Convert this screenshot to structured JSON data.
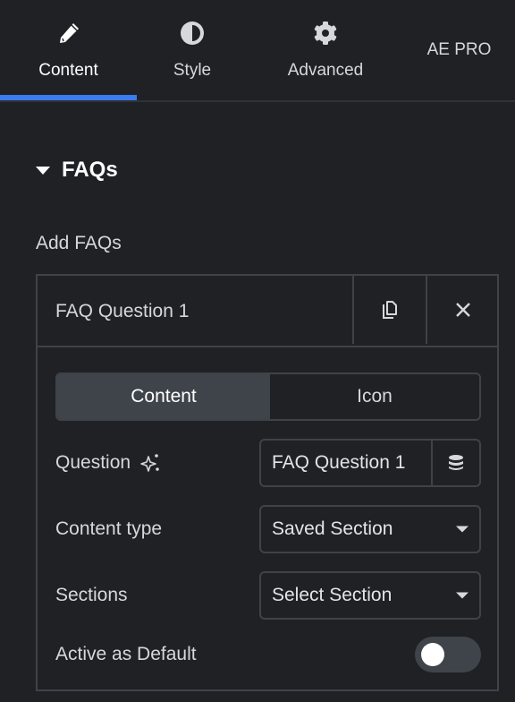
{
  "tabs": [
    {
      "label": "Content",
      "icon": "pencil-icon",
      "active": true
    },
    {
      "label": "Style",
      "icon": "half-circle-icon",
      "active": false
    },
    {
      "label": "Advanced",
      "icon": "gear-icon",
      "active": false
    },
    {
      "label": "AE PRO",
      "active": false
    }
  ],
  "colors": {
    "accent": "#3a7bef",
    "background": "#1f2124",
    "border": "#3f4248"
  },
  "section": {
    "title": "FAQs",
    "expanded": true
  },
  "repeater": {
    "label": "Add FAQs",
    "item": {
      "title": "FAQ Question 1",
      "duplicate_icon": "copy-icon",
      "remove_icon": "close-icon",
      "switcher": {
        "options": [
          "Content",
          "Icon"
        ],
        "selected": "Content"
      },
      "fields": {
        "question": {
          "label": "Question",
          "ai_icon": "sparkle-icon",
          "value": "FAQ Question 1",
          "dynamic_icon": "database-icon"
        },
        "content_type": {
          "label": "Content type",
          "value": "Saved Section"
        },
        "sections": {
          "label": "Sections",
          "value": "Select Section"
        },
        "active_default": {
          "label": "Active as Default",
          "on": false
        }
      }
    }
  }
}
